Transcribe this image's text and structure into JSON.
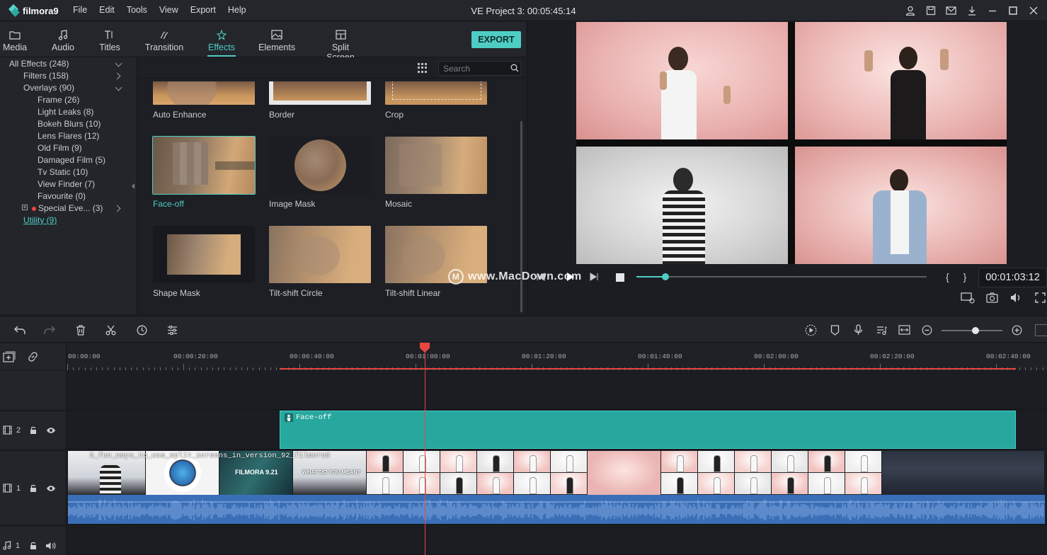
{
  "app": {
    "name": "filmora9"
  },
  "menu": [
    "File",
    "Edit",
    "Tools",
    "View",
    "Export",
    "Help"
  ],
  "project_title": "VE Project 3: 00:05:45:14",
  "tabs": [
    {
      "label": "Media",
      "icon": "folder-icon"
    },
    {
      "label": "Audio",
      "icon": "music-note-icon"
    },
    {
      "label": "Titles",
      "icon": "titles-icon"
    },
    {
      "label": "Transition",
      "icon": "transition-icon"
    },
    {
      "label": "Effects",
      "icon": "effects-icon",
      "active": true
    },
    {
      "label": "Elements",
      "icon": "image-icon"
    },
    {
      "label": "Split Screen",
      "icon": "split-screen-icon"
    }
  ],
  "export_label": "EXPORT",
  "tree": {
    "all_effects": "All Effects (248)",
    "filters": "Filters (158)",
    "overlays": "Overlays (90)",
    "overlay_children": [
      "Frame (26)",
      "Light Leaks (8)",
      "Bokeh Blurs (10)",
      "Lens Flares (12)",
      "Old Film (9)",
      "Damaged Film (5)",
      "Tv Static (10)",
      "View Finder (7)",
      "Favourite (0)"
    ],
    "special": "Special Eve... (3)",
    "utility": "Utility (9)"
  },
  "search": {
    "placeholder": "Search"
  },
  "effects": [
    {
      "label": "Auto Enhance"
    },
    {
      "label": "Border"
    },
    {
      "label": "Crop"
    },
    {
      "label": "Face-off",
      "selected": true
    },
    {
      "label": "Image Mask"
    },
    {
      "label": "Mosaic"
    },
    {
      "label": "Shape Mask"
    },
    {
      "label": "Tilt-shift Circle"
    },
    {
      "label": "Tilt-shift Linear"
    }
  ],
  "preview": {
    "timecode": "00:01:03:12",
    "watermark": "www.MacDown.com",
    "watermark_logo": "M",
    "braces": "{ }",
    "progress": 0.1
  },
  "ruler": [
    "00:00:00",
    "00:00:20:00",
    "00:00:40:00",
    "00:01:00:00",
    "00:01:20:00",
    "00:01:40:00",
    "00:02:00:00",
    "00:02:20:00",
    "00:02:40:00"
  ],
  "tracks": {
    "effect_track_num": "2",
    "video_track_num": "1",
    "audio_track_num": "1",
    "effect_clip_label": "Face-off",
    "video_clip_label": "3_fun_ways_to_use_split_screens_in_version_92_filmora9",
    "clip_text_1": "FILMORA 9.21",
    "clip_text_2": "WHAT DO YOU MEAN?"
  },
  "colors": {
    "accent": "#4ecdc4",
    "playhead": "#e8463f",
    "audio": "#3a6fb8",
    "effect_clip": "#27a79e"
  }
}
